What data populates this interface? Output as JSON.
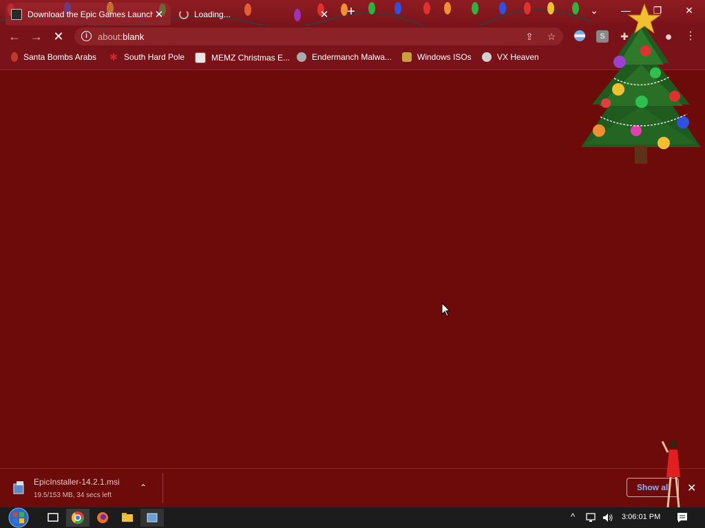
{
  "tabs": [
    {
      "title": "Download the Epic Games Launcher",
      "close": "✕"
    },
    {
      "title": "Loading...",
      "close": "✕"
    }
  ],
  "new_tab_label": "+",
  "window_controls": {
    "tab_search": "⌄",
    "minimize": "—",
    "restore": "❐",
    "close": "✕"
  },
  "toolbar": {
    "back": "←",
    "forward": "→",
    "stop": "✕",
    "info": "i",
    "url_prefix": "about:",
    "url_suffix": "blank",
    "share": "⇪",
    "star": "☆",
    "ext_s": "S",
    "puzzle": "✚",
    "profile": "●",
    "menu": "⋮"
  },
  "bookmarks": [
    {
      "label": "Santa Bombs Arabs",
      "color": "#c0392b"
    },
    {
      "label": "South Hard Pole",
      "color": "#d62828"
    },
    {
      "label": "MEMZ Christmas E...",
      "color": "#e8e8e8"
    },
    {
      "label": "Endermanch Malwa...",
      "color": "#aaaaaa"
    },
    {
      "label": "Windows ISOs",
      "color": "#c8a040"
    },
    {
      "label": "VX Heaven",
      "color": "#d0d0d0"
    }
  ],
  "download": {
    "filename": "EpicInstaller-14.2.1.msi",
    "status": "19.5/153 MB, 34 secs left",
    "chevron": "⌃",
    "show_all": "Show all",
    "close": "✕"
  },
  "taskbar": {
    "tray_chevron": "^",
    "clock": "3:06:01 PM"
  },
  "colors": {
    "page_bg": "#6d0a0a",
    "chrome_frame": "#7a1319",
    "accent_link": "#8ab4f8"
  }
}
